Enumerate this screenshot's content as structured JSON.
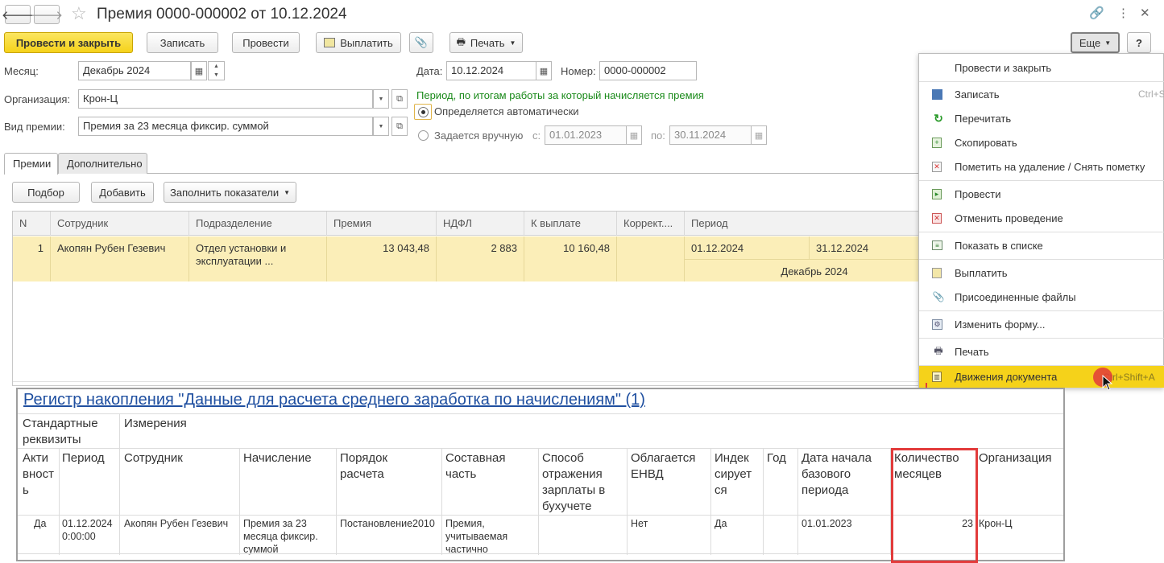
{
  "window": {
    "title": "Премия 0000-000002 от 10.12.2024"
  },
  "toolbar": {
    "post_close": "Провести и закрыть",
    "save": "Записать",
    "post": "Провести",
    "pay": "Выплатить",
    "print": "Печать",
    "more": "Еще",
    "help": "?"
  },
  "form": {
    "month_label": "Месяц:",
    "month_value": "Декабрь 2024",
    "date_label": "Дата:",
    "date_value": "10.12.2024",
    "number_label": "Номер:",
    "number_value": "0000-000002",
    "org_label": "Организация:",
    "org_value": "Крон-Ц",
    "bonus_type_label": "Вид премии:",
    "bonus_type_value": "Премия за 23 месяца фиксир. суммой",
    "period_caption": "Период, по итогам работы за который начисляется премия",
    "radio_auto": "Определяется автоматически",
    "radio_manual": "Задается вручную",
    "from_label": "с:",
    "from_value": "01.01.2023",
    "to_label": "по:",
    "to_value": "30.11.2024"
  },
  "tabs": [
    "Премии",
    "Дополнительно"
  ],
  "grid_toolbar": {
    "select": "Подбор",
    "add": "Добавить",
    "fill": "Заполнить показатели"
  },
  "grid": {
    "columns": [
      "N",
      "Сотрудник",
      "Подразделение",
      "Премия",
      "НДФЛ",
      "К выплате",
      "Коррект....",
      "Период"
    ],
    "row": {
      "n": "1",
      "employee": "Акопян Рубен Гезевич",
      "dept_line1": "Отдел установки и",
      "dept_line2": "эксплуатации ...",
      "bonus": "13 043,48",
      "ndfl": "2 883",
      "payout": "10 160,48",
      "period_from": "01.12.2024",
      "period_to": "31.12.2024",
      "period_month": "Декабрь 2024"
    }
  },
  "menu": {
    "items": [
      {
        "label": "Провести и закрыть",
        "shortcut": ""
      },
      {
        "label": "Записать",
        "shortcut": "Ctrl+S"
      },
      {
        "label": "Перечитать",
        "shortcut": ""
      },
      {
        "label": "Скопировать",
        "shortcut": ""
      },
      {
        "label": "Пометить на удаление / Снять пометку",
        "shortcut": ""
      },
      {
        "label": "Провести",
        "shortcut": ""
      },
      {
        "label": "Отменить проведение",
        "shortcut": ""
      },
      {
        "label": "Показать в списке",
        "shortcut": ""
      },
      {
        "label": "Выплатить",
        "shortcut": ""
      },
      {
        "label": "Присоединенные файлы",
        "shortcut": ""
      },
      {
        "label": "Изменить форму...",
        "shortcut": ""
      },
      {
        "label": "Печать",
        "shortcut": ""
      },
      {
        "label": "Движения документа",
        "shortcut": "Ctrl+Shift+A"
      }
    ]
  },
  "register": {
    "title": "Регистр накопления \"Данные для расчета среднего заработка по начислениям\" (1)",
    "group_std_l1": "Стандартные",
    "group_std_l2": "реквизиты",
    "group_dims": "Измерения",
    "headers": {
      "active": [
        "Акти",
        "вност",
        "ь"
      ],
      "period": [
        "Период"
      ],
      "employee": [
        "Сотрудник"
      ],
      "accrual": [
        "Начисление"
      ],
      "calc_order": [
        "Порядок",
        "расчета"
      ],
      "component": [
        "Составная",
        "часть"
      ],
      "reflection": [
        "Способ",
        "отражения",
        "зарплаты в",
        "бухучете"
      ],
      "envd": [
        "Облагается",
        "ЕНВД"
      ],
      "indexed": [
        "Индек",
        "сирует",
        "ся"
      ],
      "year": [
        "Год"
      ],
      "base_start": [
        "Дата начала",
        "базового",
        "периода"
      ],
      "months": [
        "Количество",
        "месяцев"
      ],
      "org": [
        "Организация"
      ]
    },
    "row": {
      "active": "Да",
      "period_l1": "01.12.2024",
      "period_l2": "0:00:00",
      "employee": "Акопян Рубен Гезевич",
      "accrual_l1": "Премия за 23",
      "accrual_l2": "месяца фиксир.",
      "accrual_l3": "суммой",
      "calc_order": "Постановление2010",
      "component_l1": "Премия,",
      "component_l2": "учитываемая",
      "component_l3": "частично",
      "envd": "Нет",
      "indexed": "Да",
      "base_start": "01.01.2023",
      "months": "23",
      "org": "Крон-Ц"
    }
  },
  "colors": {
    "accent_yellow": "#f5d21a",
    "selected_row": "#fbeeb8",
    "link_blue": "#1f4fa0",
    "caption_green": "#1a8a1a",
    "highlight_red": "#e23b3b"
  }
}
